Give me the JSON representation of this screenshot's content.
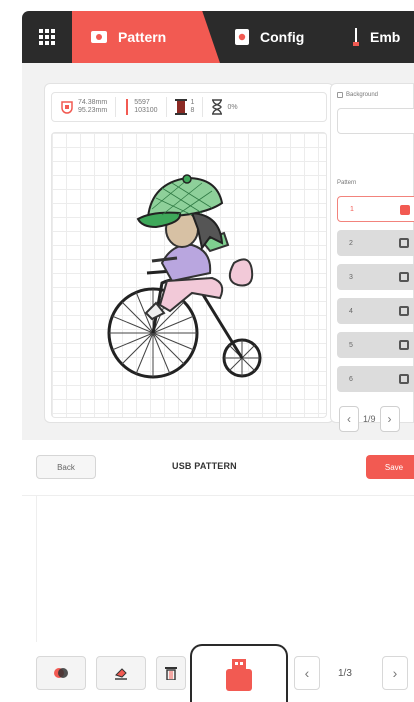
{
  "tabs": {
    "pattern": "Pattern",
    "config": "Config",
    "emb": "Emb"
  },
  "info": {
    "size_w": "74.38mm",
    "size_h": "95.23mm",
    "stitches_a": "5597",
    "stitches_b": "103100",
    "thread_a": "1",
    "thread_b": "8",
    "time": "0%"
  },
  "side": {
    "background_label": "Background",
    "pattern_label": "Pattern",
    "items": [
      "1",
      "2",
      "3",
      "4",
      "5",
      "6"
    ],
    "page": "1/9"
  },
  "usb": {
    "back": "Back",
    "title": "USB PATTERN",
    "save": "Save",
    "page": "1/3"
  },
  "colors": {
    "accent": "#f25a52",
    "dark": "#2b2b2b"
  },
  "icons": [
    "grid-menu-icon",
    "pattern-icon",
    "config-icon",
    "emb-icon",
    "usb-icon"
  ]
}
